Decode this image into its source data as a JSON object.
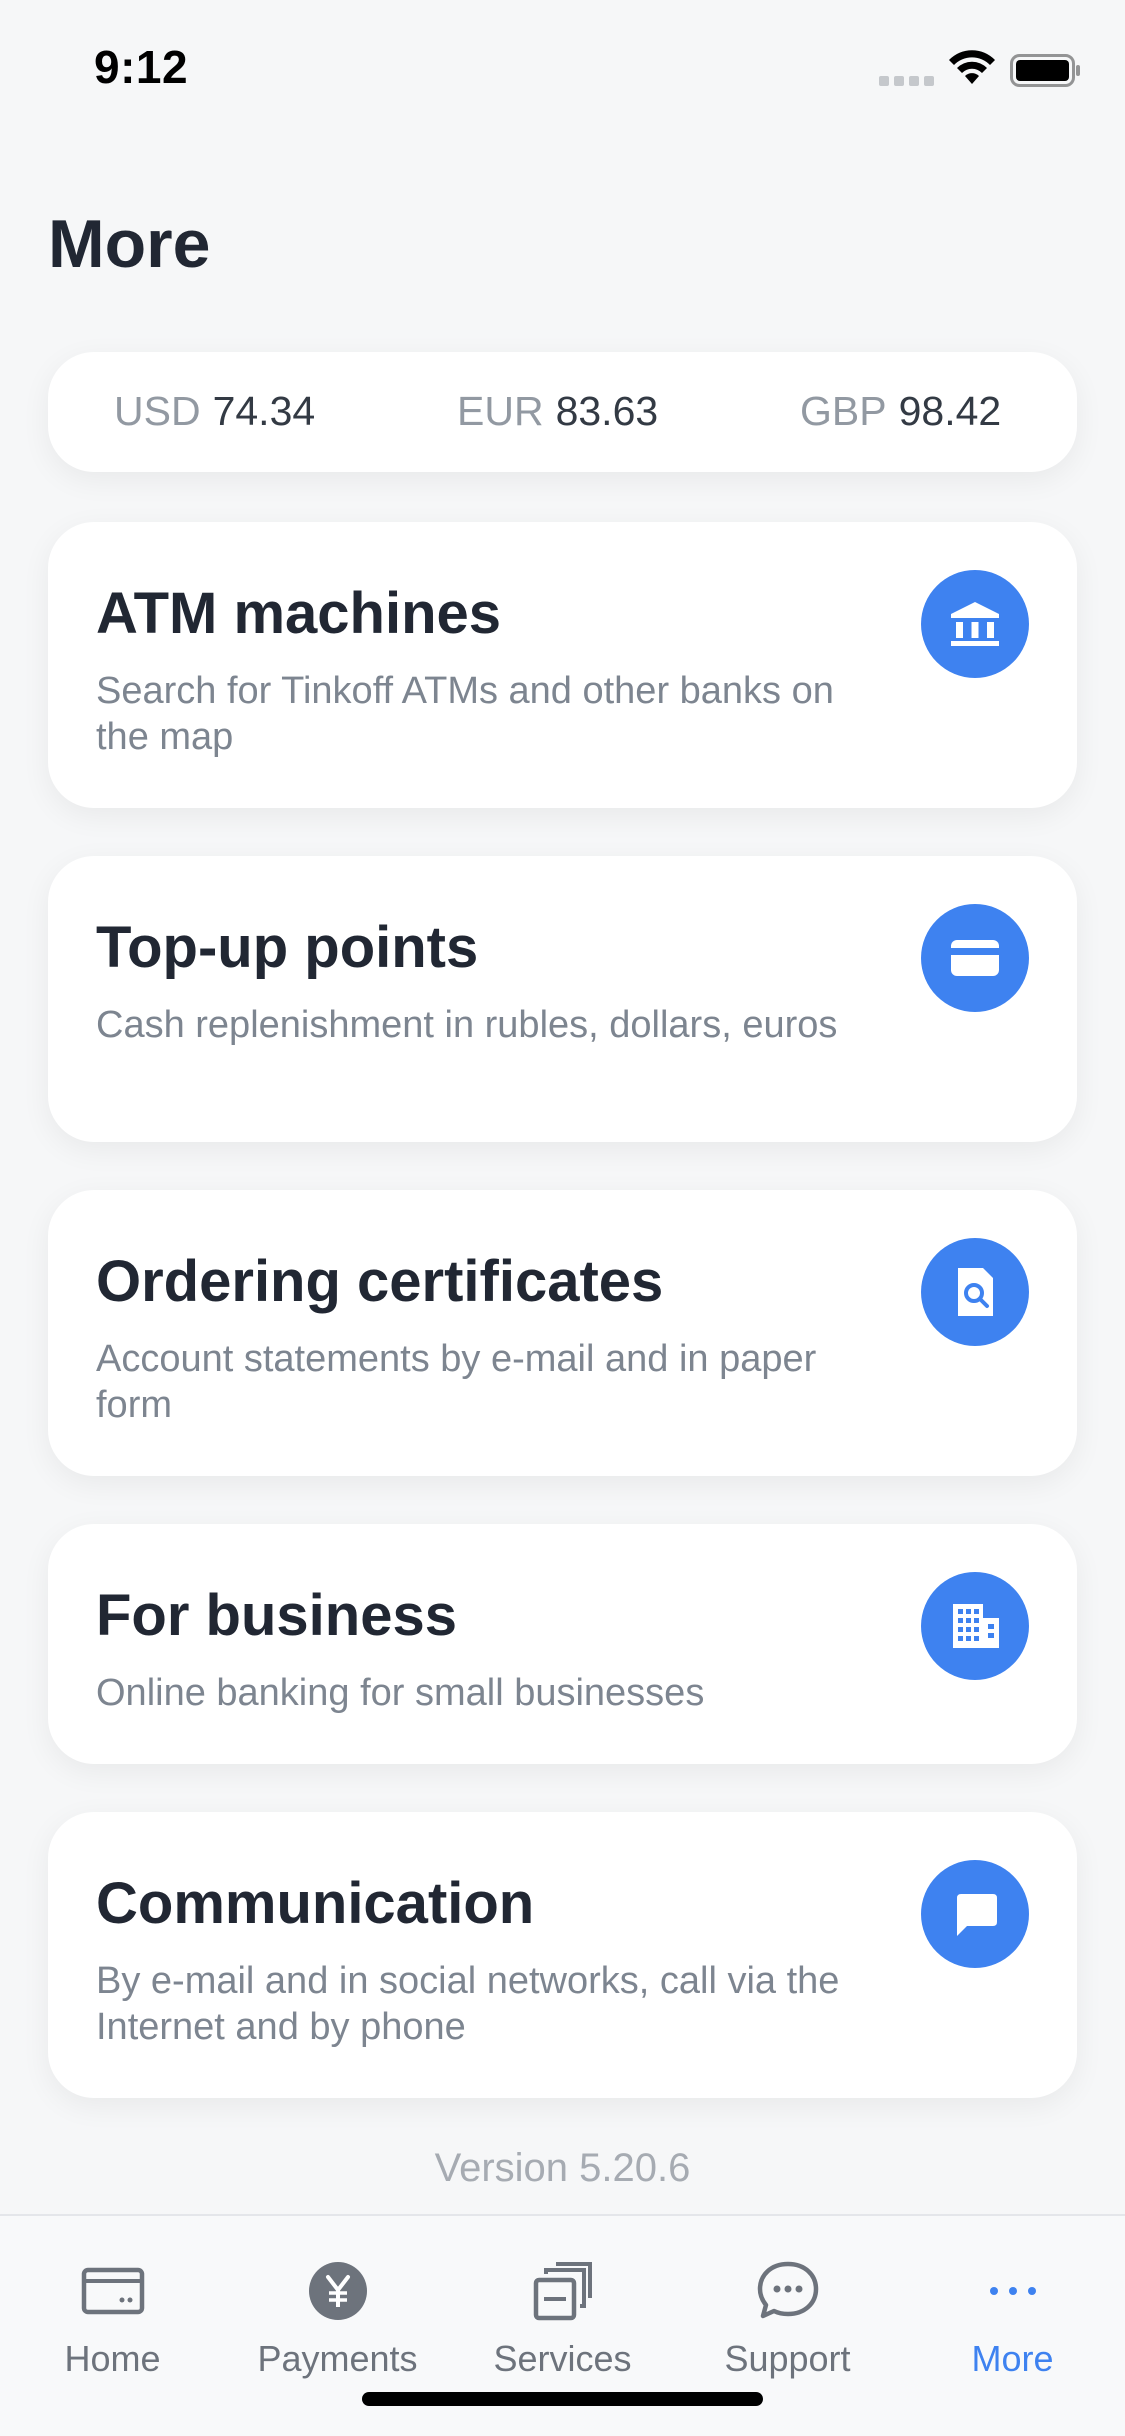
{
  "status_bar": {
    "time": "9:12"
  },
  "page": {
    "title": "More"
  },
  "rates": [
    {
      "code": "USD",
      "value": "74.34"
    },
    {
      "code": "EUR",
      "value": "83.63"
    },
    {
      "code": "GBP",
      "value": "98.42"
    }
  ],
  "menu": [
    {
      "title": "ATM machines",
      "description": "Search for Tinkoff ATMs and other banks on the map",
      "icon": "bank-icon"
    },
    {
      "title": "Top-up points",
      "description": "Cash replenishment in rubles, dollars, euros",
      "icon": "card-icon"
    },
    {
      "title": "Ordering certificates",
      "description": "Account statements by e-mail and in paper form",
      "icon": "document-search-icon"
    },
    {
      "title": "For business",
      "description": "Online banking for small businesses",
      "icon": "building-icon"
    },
    {
      "title": "Communication",
      "description": "By e-mail and in social networks, call via the Internet and by phone",
      "icon": "chat-icon"
    }
  ],
  "version": "Version 5.20.6",
  "tabs": [
    {
      "label": "Home",
      "icon": "wallet-icon",
      "active": false
    },
    {
      "label": "Payments",
      "icon": "yen-icon",
      "active": false
    },
    {
      "label": "Services",
      "icon": "stack-icon",
      "active": false
    },
    {
      "label": "Support",
      "icon": "speech-bubble-icon",
      "active": false
    },
    {
      "label": "More",
      "icon": "dots-icon",
      "active": true
    }
  ],
  "colors": {
    "accent": "#3e82f0",
    "background": "#f6f7f8",
    "card": "#ffffff",
    "title": "#212733",
    "muted": "#7d8590"
  }
}
